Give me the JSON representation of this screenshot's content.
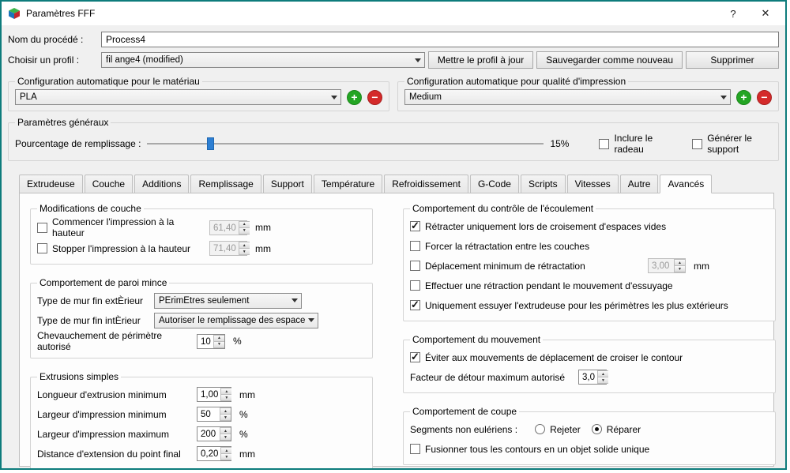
{
  "window": {
    "title": "Paramètres FFF",
    "help_label": "?",
    "close_label": "✕"
  },
  "header": {
    "process_name_label": "Nom du procédé :",
    "process_name_value": "Process4",
    "profile_label": "Choisir un profil :",
    "profile_value": "fil ange4 (modified)",
    "update_profile_label": "Mettre le profil à jour",
    "save_new_label": "Sauvegarder comme nouveau",
    "delete_label": "Supprimer"
  },
  "auto_material": {
    "title": "Configuration automatique pour le matériau",
    "value": "PLA",
    "add_label": "+",
    "remove_label": "−"
  },
  "auto_quality": {
    "title": "Configuration automatique pour qualité d'impression",
    "value": "Medium",
    "add_label": "+",
    "remove_label": "−"
  },
  "general": {
    "title": "Paramètres généraux",
    "infill_label": "Pourcentage de remplissage :",
    "infill_value": "15%",
    "raft_label": "Inclure le radeau",
    "raft_checked": false,
    "support_label": "Générer le support",
    "support_checked": false
  },
  "tabs": {
    "items": [
      "Extrudeuse",
      "Couche",
      "Additions",
      "Remplissage",
      "Support",
      "Température",
      "Refroidissement",
      "G-Code",
      "Scripts",
      "Vitesses",
      "Autre",
      "Avancés"
    ],
    "active": "Avancés"
  },
  "advanced": {
    "layer_mods": {
      "title": "Modifications de couche",
      "start_label": "Commencer l'impression à la hauteur",
      "start_checked": false,
      "start_value": "61,40",
      "start_unit": "mm",
      "stop_label": "Stopper  l'impression à la hauteur",
      "stop_checked": false,
      "stop_value": "71,40",
      "stop_unit": "mm"
    },
    "thin_wall": {
      "title": "Comportement de paroi mince",
      "ext_label": "Type de mur fin extÈrieur",
      "ext_value": "PÈrimÈtres seulement",
      "int_label": "Type de mur fin intÈrieur",
      "int_value": "Autoriser le remplissage des espaces",
      "overlap_label": "Chevauchement de périmètre autorisé",
      "overlap_value": "10",
      "overlap_unit": "%"
    },
    "single_extrusions": {
      "title": "Extrusions simples",
      "rows": [
        {
          "label": "Longueur d'extrusion minimum",
          "value": "1,00",
          "unit": "mm"
        },
        {
          "label": "Largeur d'impression minimum",
          "value": "50",
          "unit": "%"
        },
        {
          "label": "Largeur d'impression maximum",
          "value": "200",
          "unit": "%"
        },
        {
          "label": "Distance d'extension du point final",
          "value": "0,20",
          "unit": "mm"
        }
      ]
    },
    "ooze": {
      "title": "Comportement du contrôle de l'écoulement",
      "items": [
        {
          "label": "Rétracter uniquement lors de croisement d'espaces vides",
          "checked": true
        },
        {
          "label": "Forcer la rétractation entre les couches",
          "checked": false
        },
        {
          "label": "Déplacement minimum de rétractation",
          "checked": false,
          "value": "3,00",
          "unit": "mm"
        },
        {
          "label": "Effectuer une rétraction pendant le mouvement d'essuyage",
          "checked": false
        },
        {
          "label": "Uniquement essuyer l'extrudeuse pour les périmètres les plus extérieurs",
          "checked": true
        }
      ]
    },
    "movement": {
      "title": "Comportement du mouvement",
      "avoid_label": "Éviter aux mouvements de déplacement de croiser le contour",
      "avoid_checked": true,
      "factor_label": "Facteur de détour maximum autorisé",
      "factor_value": "3,0"
    },
    "slicing": {
      "title": "Comportement de coupe",
      "segments_label": "Segments non eulériens :",
      "reject_label": "Rejeter",
      "reject_selected": false,
      "repair_label": "Réparer",
      "repair_selected": true,
      "merge_label": "Fusionner tous les contours en un objet solide unique",
      "merge_checked": false
    }
  }
}
